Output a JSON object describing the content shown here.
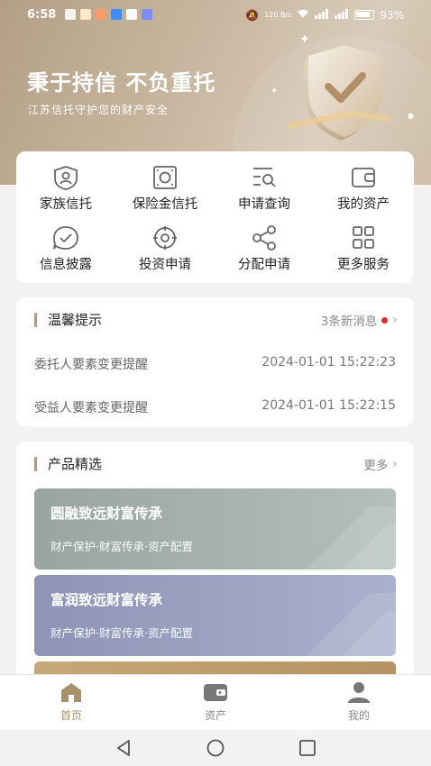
{
  "status_bar": {
    "time": "6:58",
    "net_speed": "120 B/s",
    "battery": "93%"
  },
  "hero": {
    "slogan": "秉于持信 不负重托",
    "subtitle": "江苏信托守护您的财产安全"
  },
  "services": [
    {
      "label": "家族信托",
      "icon": "family-trust-icon"
    },
    {
      "label": "保险金信托",
      "icon": "insurance-trust-icon"
    },
    {
      "label": "申请查询",
      "icon": "query-icon"
    },
    {
      "label": "我的资产",
      "icon": "wallet-icon"
    },
    {
      "label": "信息披露",
      "icon": "disclosure-icon"
    },
    {
      "label": "投资申请",
      "icon": "invest-icon"
    },
    {
      "label": "分配申请",
      "icon": "share-icon"
    },
    {
      "label": "更多服务",
      "icon": "grid-icon"
    }
  ],
  "notice": {
    "title": "温馨提示",
    "new_count": "3条新消息",
    "items": [
      {
        "text": "委托人要素变更提醒",
        "time": "2024-01-01 15:22:23"
      },
      {
        "text": "受益人要素变更提醒",
        "time": "2024-01-01 15:22:15"
      }
    ]
  },
  "products": {
    "title": "产品精选",
    "more": "更多",
    "items": [
      {
        "name": "圆融致远财富传承",
        "tags": "财产保护·财富传承·资产配置",
        "color": "#98a5a1"
      },
      {
        "name": "富润致远财富传承",
        "tags": "财产保护·财富传承·资产配置",
        "color": "#8e94b6"
      }
    ]
  },
  "tabbar": {
    "home": "首页",
    "assets": "资产",
    "mine": "我的",
    "accent": "#a8906f"
  },
  "colors": {
    "hero": "#b39f86",
    "accent": "#b19a7f",
    "alert_dot": "#d6322a"
  }
}
